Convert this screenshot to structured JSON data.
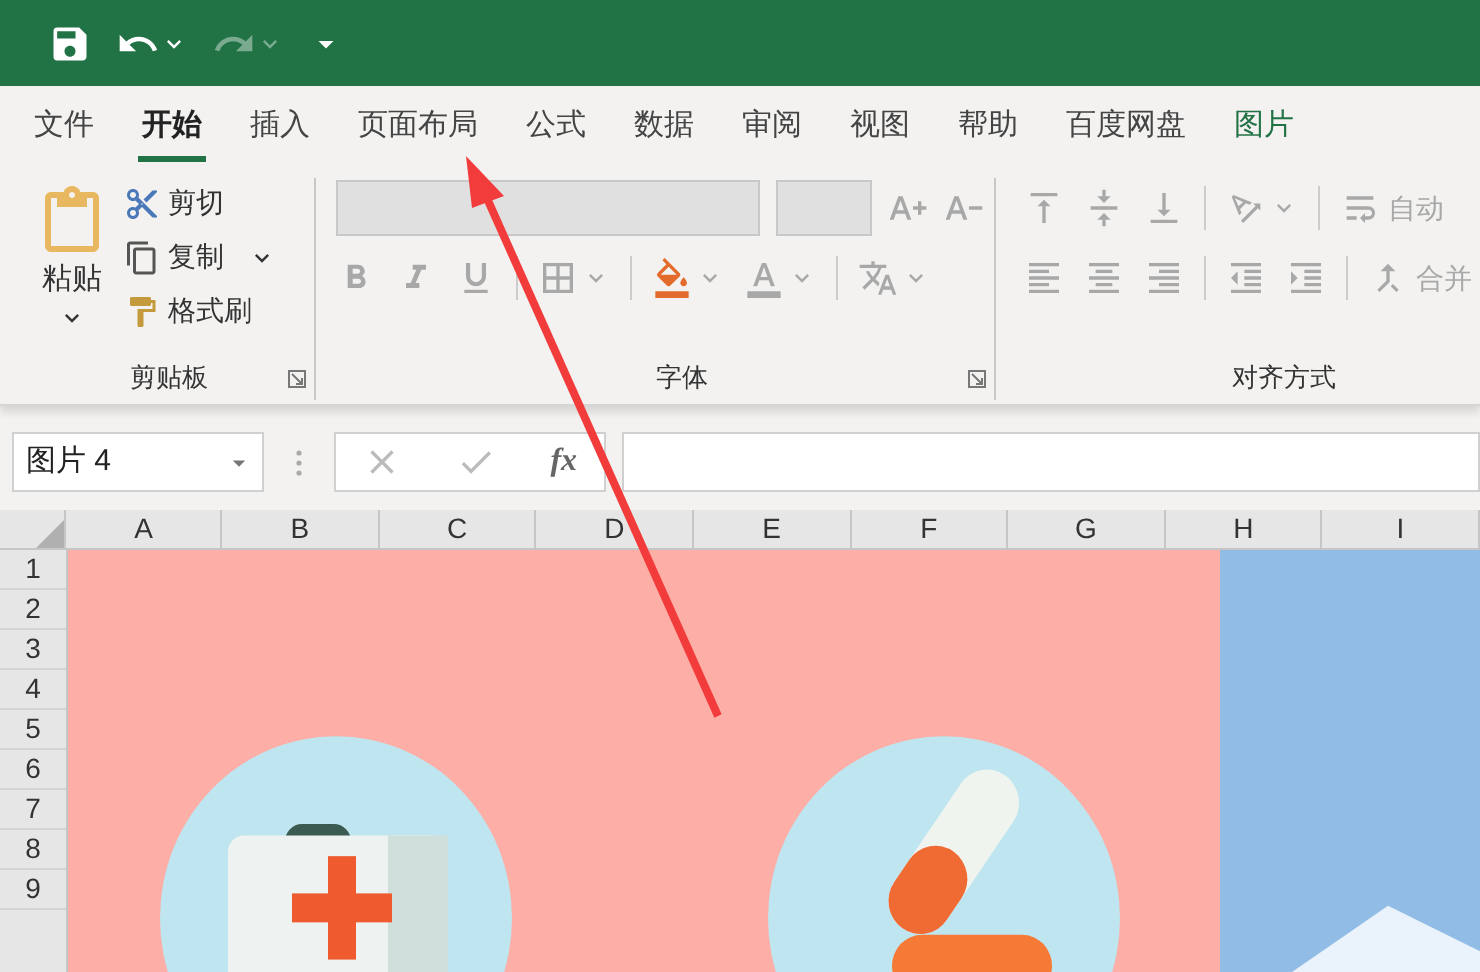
{
  "quick_access": {
    "redo_disabled": true
  },
  "tabs": [
    {
      "label": "文件",
      "selected": false,
      "kind": "normal"
    },
    {
      "label": "开始",
      "selected": true,
      "kind": "normal"
    },
    {
      "label": "插入",
      "selected": false,
      "kind": "normal"
    },
    {
      "label": "页面布局",
      "selected": false,
      "kind": "normal"
    },
    {
      "label": "公式",
      "selected": false,
      "kind": "normal"
    },
    {
      "label": "数据",
      "selected": false,
      "kind": "normal"
    },
    {
      "label": "审阅",
      "selected": false,
      "kind": "normal"
    },
    {
      "label": "视图",
      "selected": false,
      "kind": "normal"
    },
    {
      "label": "帮助",
      "selected": false,
      "kind": "normal"
    },
    {
      "label": "百度网盘",
      "selected": false,
      "kind": "normal"
    },
    {
      "label": "图片",
      "selected": false,
      "kind": "contextual"
    }
  ],
  "clipboard": {
    "paste": "粘贴",
    "cut": "剪切",
    "copy": "复制",
    "format_painter": "格式刷",
    "group_label": "剪贴板"
  },
  "font": {
    "disabled": true,
    "group_label": "字体"
  },
  "alignment": {
    "disabled": true,
    "wrap": "自动",
    "merge": "合并",
    "group_label": "对齐方式"
  },
  "name_box": {
    "value": "图片 4"
  },
  "formula_bar": {
    "function_label": "fx"
  },
  "columns": [
    "A",
    "B",
    "C",
    "D",
    "E",
    "F",
    "G",
    "H",
    "I"
  ],
  "rows": [
    "1",
    "2",
    "3",
    "4",
    "5",
    "6",
    "7",
    "8",
    "9"
  ]
}
